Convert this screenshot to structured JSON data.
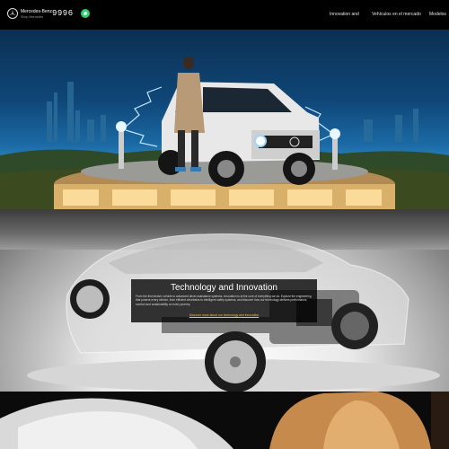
{
  "header": {
    "brand_name": "Mercedes-Benz",
    "brand_sub": "Shop Mercedes",
    "phone": "9996",
    "logo_icon": "mercedes-star-icon",
    "whatsapp_icon": "whatsapp-icon",
    "nav": [
      "Innovation and",
      "Vehículos en el mercado",
      "Modelos"
    ]
  },
  "hero": {
    "image": "person-standing-beside-electric-g-class-suv-on-illuminated-platform",
    "colors": {
      "sky": "#0f4778",
      "lightning": "#bfe6ff"
    }
  },
  "tech": {
    "title": "Technology and Innovation",
    "body": "From the first electric vehicle to advanced driver assistance systems, innovation is at the core of everything we do. Explore the engineering that powers every vehicle, from efficient drivetrains to intelligent safety systems, and discover how our technology delivers performance, comfort and sustainability on every journey.",
    "link": "Discover more about our technology and innovation"
  },
  "bottom": {
    "image": "vehicle-interior-seats-detail"
  }
}
